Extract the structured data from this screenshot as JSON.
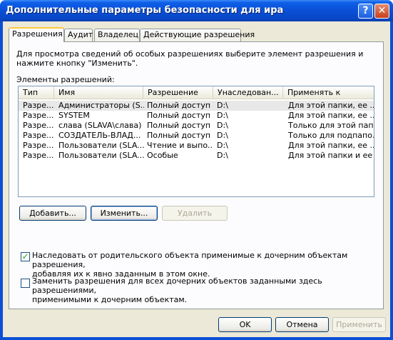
{
  "window": {
    "title": "Дополнительные параметры безопасности для ира"
  },
  "titlebar": {
    "help_glyph": "?",
    "close_glyph": "✕"
  },
  "tabs": [
    {
      "label": "Разрешения",
      "active": true
    },
    {
      "label": "Аудит",
      "active": false
    },
    {
      "label": "Владелец",
      "active": false
    },
    {
      "label": "Действующие разрешения",
      "active": false
    }
  ],
  "description": "Для просмотра сведений об особых разрешениях выберите элемент разрешения и нажмите кнопку \"Изменить\".",
  "list_label": "Элементы разрешений:",
  "columns": [
    "Тип",
    "Имя",
    "Разрешение",
    "Унаследован...",
    "Применять к"
  ],
  "rows": [
    [
      "Разре...",
      "Администраторы (S...",
      "Полный доступ",
      "D:\\",
      "Для этой папки, ее ..."
    ],
    [
      "Разре...",
      "SYSTEM",
      "Полный доступ",
      "D:\\",
      "Для этой папки, ее ..."
    ],
    [
      "Разре...",
      "слава (SLAVA\\слава)",
      "Полный доступ",
      "D:\\",
      "Только для этой пап..."
    ],
    [
      "Разре...",
      "СОЗДАТЕЛЬ-ВЛАД...",
      "Полный доступ",
      "D:\\",
      "Только для подпапо..."
    ],
    [
      "Разре...",
      "Пользователи (SLA...",
      "Чтение и выпо...",
      "D:\\",
      "Для этой папки, ее ..."
    ],
    [
      "Разре...",
      "Пользователи (SLA...",
      "Особые",
      "D:\\",
      "Для этой папки и ее ..."
    ]
  ],
  "buttons": {
    "add": "Добавить...",
    "edit": "Изменить...",
    "remove": "Удалить",
    "ok": "OK",
    "cancel": "Отмена",
    "apply": "Применить"
  },
  "checkboxes": {
    "inherit": {
      "line1": "Наследовать от родительского объекта применимые к дочерним объектам разрешения,",
      "line2": "добавляя их к явно заданным в этом окне.",
      "checked": true,
      "mark": "✓"
    },
    "replace": {
      "line1": "Заменить разрешения для всех дочерних объектов заданными здесь разрешениями,",
      "line2": "применимыми к дочерним объектам.",
      "checked": false
    }
  },
  "colors": {
    "titlebar": "#0a4fd6",
    "dialog_bg": "#ece9d8",
    "tab_highlight": "#ffc73c"
  }
}
